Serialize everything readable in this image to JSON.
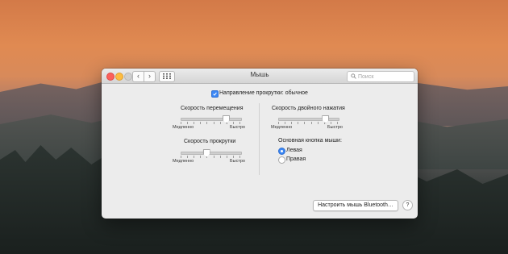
{
  "window": {
    "title": "Мышь",
    "search_placeholder": "Поиск"
  },
  "scroll_direction": {
    "label": "Направление прокрутки: обычное",
    "checked": true
  },
  "tracking_speed": {
    "label": "Скорость перемещения",
    "min_label": "Медленно",
    "max_label": "Быстро",
    "value": 0.75
  },
  "scroll_speed": {
    "label": "Скорость прокрутки",
    "min_label": "Медленно",
    "max_label": "Быстро",
    "value": 0.42
  },
  "double_click_speed": {
    "label": "Скорость двойного нажатия",
    "min_label": "Медленно",
    "max_label": "Быстро",
    "value": 0.78
  },
  "primary_button": {
    "label": "Основная кнопка мыши:",
    "options": [
      "Левая",
      "Правая"
    ],
    "selected": "Левая"
  },
  "bluetooth_button": "Настроить мышь Bluetooth…",
  "help_button": "?",
  "colors": {
    "accent": "#3b87f5"
  }
}
